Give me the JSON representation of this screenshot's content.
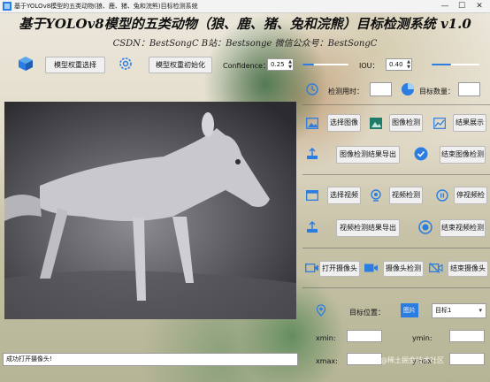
{
  "window": {
    "title": "基于YOLOv8模型的五类动物(狼、鹿、猪、兔和浣熊)目标检测系统",
    "controls": {
      "minimize": "—",
      "maximize": "☐",
      "close": "✕"
    }
  },
  "header": {
    "title": "基于YOLOv8模型的五类动物（狼、鹿、猪、兔和浣熊）目标检测系统 v1.0",
    "subtitle": "CSDN：BestSongC   B站：Bestsonge   微信公众号：BestSongC"
  },
  "toolbar": {
    "select_weights_label": "模型权重选择",
    "init_weights_label": "模型权重初始化",
    "confidence_label": "Confidence：",
    "confidence_value": "0.25",
    "confidence_level": 0.25,
    "iou_label": "IOU：",
    "iou_value": "0.40",
    "iou_level": 0.4
  },
  "stats": {
    "time_label": "检测用时：",
    "time_value": "",
    "count_label": "目标数量：",
    "count_value": ""
  },
  "image_section": {
    "select_label": "选择图像",
    "detect_label": "图像检测",
    "show_label": "结果展示",
    "export_label": "图像检测结果导出",
    "end_label": "结束图像检测"
  },
  "video_section": {
    "select_label": "选择视频",
    "detect_label": "视频检测",
    "stop_label": "停视频检",
    "export_label": "视频检测结果导出",
    "end_label": "结束视频检测"
  },
  "camera_section": {
    "open_label": "打开摄像头",
    "detect_label": "摄像头检测",
    "end_label": "结束摄像头"
  },
  "target": {
    "position_label": "目标位置：",
    "badge_text": "图片",
    "select_value": "目标1",
    "xmin_label": "xmin:",
    "ymin_label": "ymin:",
    "xmax_label": "xmax:",
    "ymax_label": "ymax:"
  },
  "status": {
    "message": "成功打开摄像头!"
  },
  "watermark": "@稀土掘金技术社区",
  "colors": {
    "accent": "#2b7de1",
    "title_bar": "#f3f3f3",
    "button_bg": "#f0f0f0"
  }
}
